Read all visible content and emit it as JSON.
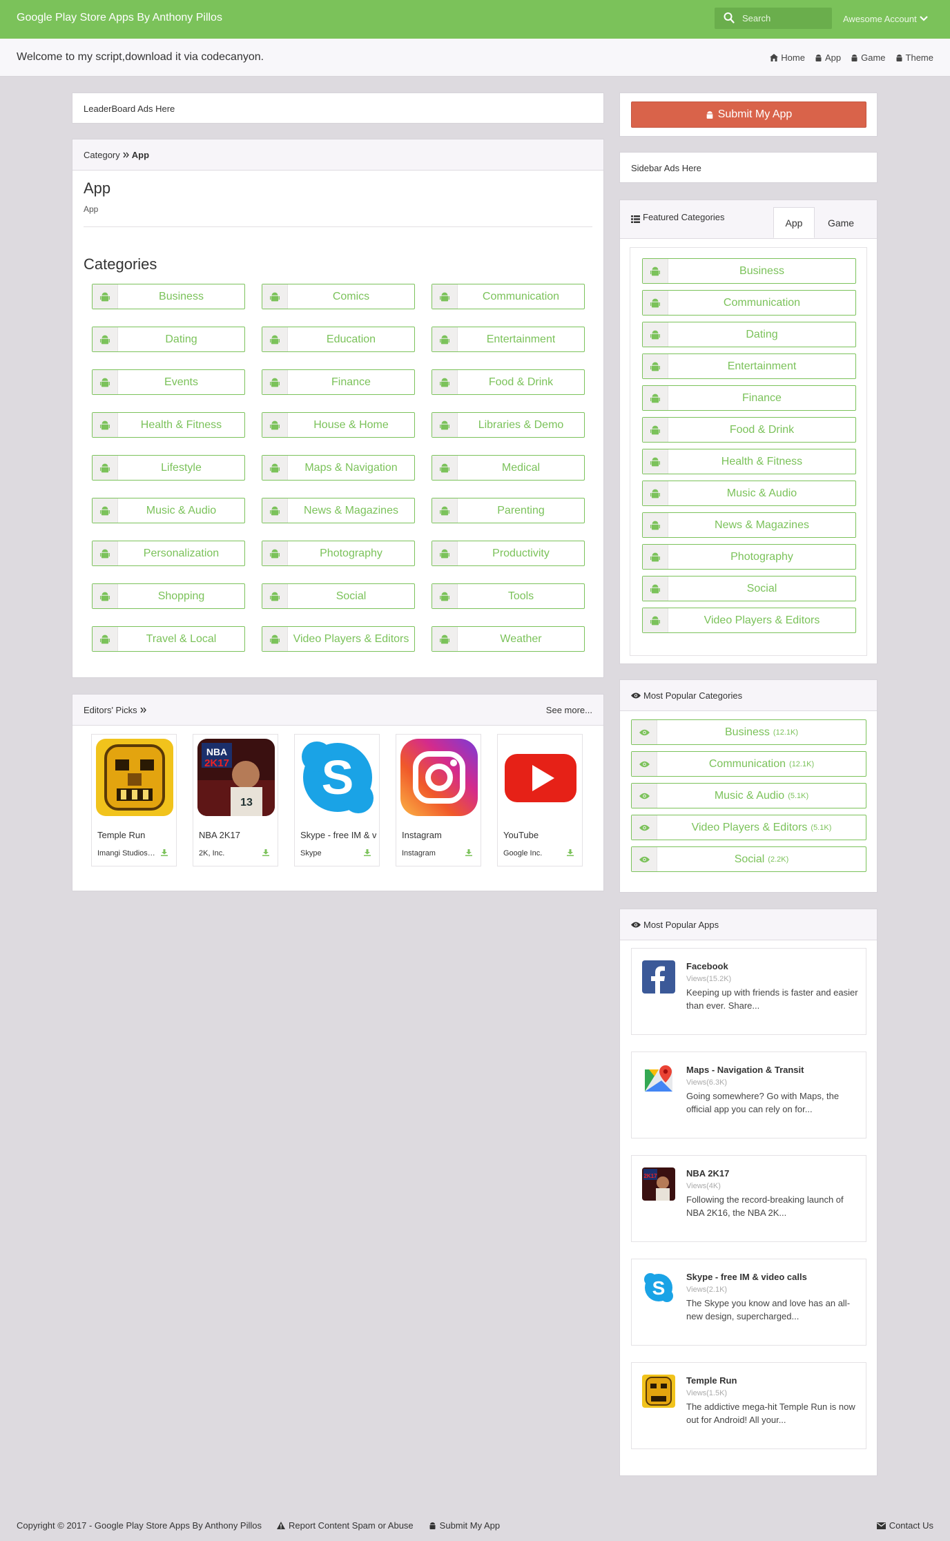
{
  "navbar": {
    "brand": "Google Play Store Apps By Anthony Pillos",
    "search_placeholder": "Search",
    "account_label": "Awesome Account"
  },
  "welcome": {
    "text": "Welcome to my script,download it via codecanyon.",
    "nav": [
      "Home",
      "App",
      "Game",
      "Theme"
    ]
  },
  "leaderboard": {
    "text": "LeaderBoard Ads Here"
  },
  "category_panel": {
    "breadcrumb_root": "Category",
    "breadcrumb_current": "App",
    "title": "App",
    "subtitle": "App",
    "categories_heading": "Categories",
    "categories": [
      "Business",
      "Comics",
      "Communication",
      "Dating",
      "Education",
      "Entertainment",
      "Events",
      "Finance",
      "Food & Drink",
      "Health & Fitness",
      "House & Home",
      "Libraries & Demo",
      "Lifestyle",
      "Maps & Navigation",
      "Medical",
      "Music & Audio",
      "News & Magazines",
      "Parenting",
      "Personalization",
      "Photography",
      "Productivity",
      "Shopping",
      "Social",
      "Tools",
      "Travel & Local",
      "Video Players & Editors",
      "Weather"
    ]
  },
  "editors_picks": {
    "title": "Editors' Picks",
    "see_more": "See more...",
    "apps": [
      {
        "name": "Temple Run",
        "dev": "Imangi Studios, LLC"
      },
      {
        "name": "NBA 2K17",
        "dev": "2K, Inc."
      },
      {
        "name": "Skype - free IM & video calls",
        "dev": "Skype"
      },
      {
        "name": "Instagram",
        "dev": "Instagram"
      },
      {
        "name": "YouTube",
        "dev": "Google Inc."
      }
    ]
  },
  "sidebar": {
    "submit_label": "Submit My App",
    "ads_text": "Sidebar Ads Here",
    "featured": {
      "title": "Featured Categories",
      "tabs": [
        "App",
        "Game"
      ],
      "items": [
        "Business",
        "Communication",
        "Dating",
        "Entertainment",
        "Finance",
        "Food & Drink",
        "Health & Fitness",
        "Music & Audio",
        "News & Magazines",
        "Photography",
        "Social",
        "Video Players & Editors"
      ]
    },
    "popular_categories": {
      "title": "Most Popular Categories",
      "items": [
        {
          "name": "Business",
          "count": "(12.1K)"
        },
        {
          "name": "Communication",
          "count": "(12.1K)"
        },
        {
          "name": "Music & Audio",
          "count": "(5.1K)"
        },
        {
          "name": "Video Players & Editors",
          "count": "(5.1K)"
        },
        {
          "name": "Social",
          "count": "(2.2K)"
        }
      ]
    },
    "popular_apps": {
      "title": "Most Popular Apps",
      "items": [
        {
          "name": "Facebook",
          "views": "Views(15.2K)",
          "desc": "Keeping up with friends is faster and easier than ever. Share..."
        },
        {
          "name": "Maps - Navigation & Transit",
          "views": "Views(6.3K)",
          "desc": "Going somewhere? Go with Maps, the official app you can rely on for..."
        },
        {
          "name": "NBA 2K17",
          "views": "Views(4K)",
          "desc": "Following the record-breaking launch of NBA 2K16, the NBA 2K..."
        },
        {
          "name": "Skype - free IM & video calls",
          "views": "Views(2.1K)",
          "desc": "The Skype you know and love has an all-new design, supercharged..."
        },
        {
          "name": "Temple Run",
          "views": "Views(1.5K)",
          "desc": "The addictive mega-hit Temple Run is now out for Android! All your..."
        }
      ]
    }
  },
  "footer": {
    "copyright": "Copyright © 2017 - Google Play Store Apps By Anthony Pillos",
    "report": "Report Content Spam or Abuse",
    "submit": "Submit My App",
    "contact": "Contact Us"
  },
  "colors": {
    "brand_green": "#7bc25a",
    "submit_red": "#d9634a"
  }
}
